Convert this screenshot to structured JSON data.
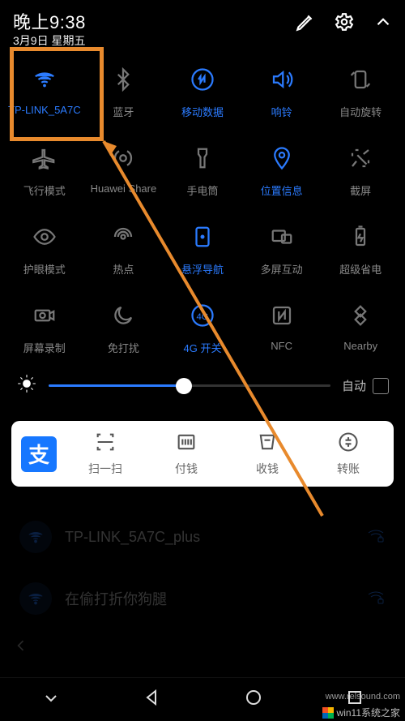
{
  "statusbar": {
    "time": "晚上9:38",
    "date": "3月9日 星期五"
  },
  "quick_settings": [
    {
      "id": "wifi",
      "label": "TP-LINK_5A7C",
      "active": true
    },
    {
      "id": "bluetooth",
      "label": "蓝牙",
      "active": false
    },
    {
      "id": "mobiledata",
      "label": "移动数据",
      "active": true
    },
    {
      "id": "sound",
      "label": "响铃",
      "active": true
    },
    {
      "id": "rotate",
      "label": "自动旋转",
      "active": false
    },
    {
      "id": "airplane",
      "label": "飞行模式",
      "active": false
    },
    {
      "id": "huaweishare",
      "label": "Huawei Share",
      "active": false
    },
    {
      "id": "flashlight",
      "label": "手电筒",
      "active": false
    },
    {
      "id": "location",
      "label": "位置信息",
      "active": true
    },
    {
      "id": "screenshot",
      "label": "截屏",
      "active": false
    },
    {
      "id": "eyecomfort",
      "label": "护眼模式",
      "active": false
    },
    {
      "id": "hotspot",
      "label": "热点",
      "active": false
    },
    {
      "id": "floatnav",
      "label": "悬浮导航",
      "active": true
    },
    {
      "id": "multiscreen",
      "label": "多屏互动",
      "active": false
    },
    {
      "id": "ultrapower",
      "label": "超级省电",
      "active": false
    },
    {
      "id": "screenrec",
      "label": "屏幕录制",
      "active": false
    },
    {
      "id": "dnd",
      "label": "免打扰",
      "active": false
    },
    {
      "id": "4gswitch",
      "label": "4G 开关",
      "active": true
    },
    {
      "id": "nfc",
      "label": "NFC",
      "active": false
    },
    {
      "id": "nearby",
      "label": "Nearby",
      "active": false
    }
  ],
  "brightness": {
    "auto_label": "自动",
    "value_percent": 48
  },
  "alipay": {
    "logo_text": "支",
    "items": [
      {
        "id": "scan",
        "label": "扫一扫"
      },
      {
        "id": "pay",
        "label": "付钱"
      },
      {
        "id": "collect",
        "label": "收钱"
      },
      {
        "id": "transfer",
        "label": "转账"
      }
    ]
  },
  "background_wifi_list": [
    {
      "ssid": "TP-LINK_5A7C_plus"
    },
    {
      "ssid": "在偷打折你狗腿"
    }
  ],
  "watermark": "win11系统之家",
  "footer": "www.relsound.com"
}
